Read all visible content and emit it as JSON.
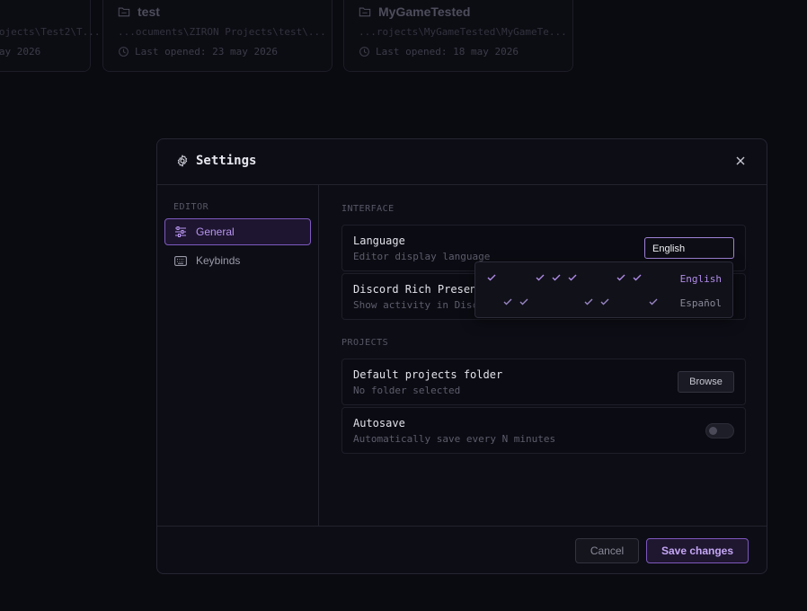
{
  "projects": [
    {
      "name": "",
      "path": "...ojects\\Test2\\T...",
      "opened": "...ay 2026"
    },
    {
      "name": "test",
      "path": "...ocuments\\ZIRON Projects\\test\\...",
      "opened": "Last opened: 23 may 2026"
    },
    {
      "name": "MyGameTested",
      "path": "...rojects\\MyGameTested\\MyGameTe...",
      "opened": "Last opened: 18 may 2026"
    }
  ],
  "modal": {
    "title": "Settings",
    "sidebar": {
      "section": "EDITOR",
      "items": [
        {
          "label": "General",
          "icon": "sliders-icon"
        },
        {
          "label": "Keybinds",
          "icon": "keyboard-icon"
        }
      ]
    },
    "interface": {
      "section": "INTERFACE",
      "language": {
        "title": "Language",
        "desc": "Editor display language",
        "value": "English"
      },
      "discord": {
        "title": "Discord Rich Presen",
        "desc": "Show activity in Disc"
      }
    },
    "projects": {
      "section": "PROJECTS",
      "folder": {
        "title": "Default projects folder",
        "desc": "No folder selected",
        "button": "Browse"
      },
      "autosave": {
        "title": "Autosave",
        "desc": "Automatically save every N minutes",
        "enabled": false
      }
    },
    "dropdown": {
      "options": [
        {
          "label": "English",
          "selected": true
        },
        {
          "label": "Español",
          "selected": false
        }
      ]
    },
    "footer": {
      "cancel": "Cancel",
      "save": "Save changes"
    }
  },
  "colors": {
    "accent": "#b795f0",
    "background": "#0a0a11",
    "panel": "#0d0d16"
  }
}
